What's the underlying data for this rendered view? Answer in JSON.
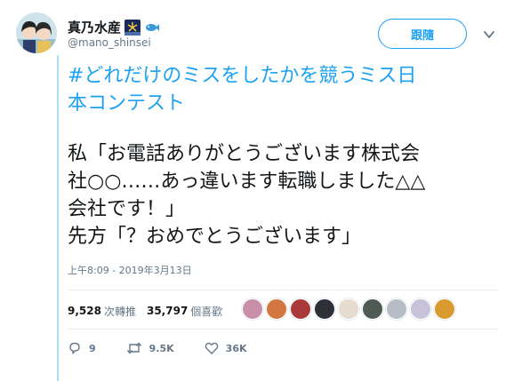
{
  "user": {
    "display_name": "真乃水産",
    "handle": "@mano_shinsei"
  },
  "follow_label": "跟隨",
  "tweet": {
    "hashtag": "#どれだけのミスをしたかを競うミス日\n本コンテスト",
    "body": "私「お電話ありがとうございます株式会\n社○○……あっ違います転職しました△△\n会社です！」\n先方「？おめでとうございます」",
    "timestamp": "上午8:09 - 2019年3月13日"
  },
  "stats": {
    "retweets": "9,528",
    "retweets_label": "次轉推",
    "likes": "35,797",
    "likes_label": "個喜歡"
  },
  "actions": {
    "replies": "9",
    "retweets": "9.5K",
    "likes": "36K"
  },
  "colors": {
    "accent": "#1da1f2",
    "text": "#14171a",
    "muted": "#657786",
    "thread_line": "#a8e0f0"
  },
  "icons": [
    "fireworks-icon",
    "fish-icon",
    "chevron-down-icon",
    "reply-icon",
    "retweet-icon",
    "like-icon"
  ]
}
